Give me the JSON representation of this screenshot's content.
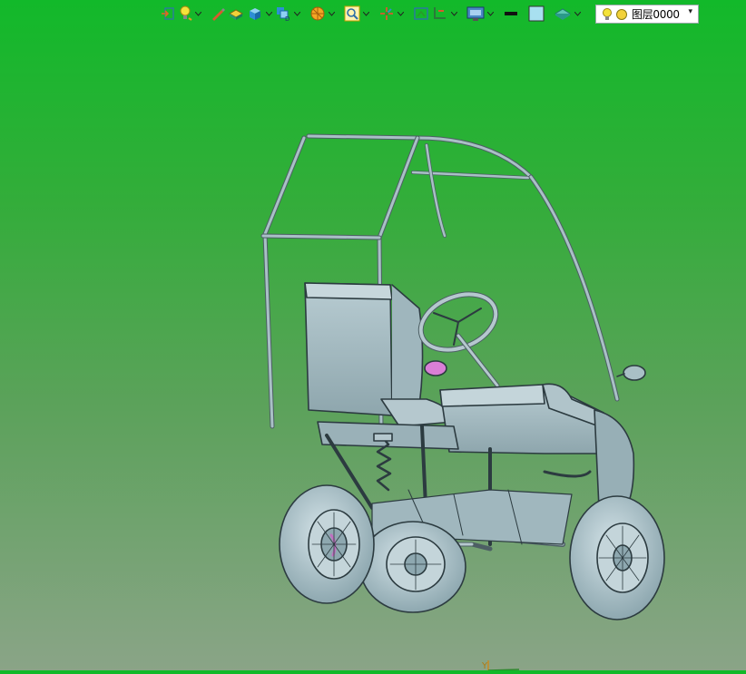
{
  "toolbar": {
    "icons": [
      "exit-icon",
      "light-bulb-icon",
      "pencil-icon",
      "box-yellow-icon",
      "cube-icon",
      "multi-cube-icon",
      "sphere-icon",
      "zoom-icon",
      "move-axes-icon",
      "frame-icon",
      "clip-icon",
      "display-icon",
      "line-icon",
      "color-square-icon",
      "layer-plate-icon"
    ]
  },
  "layer": {
    "value": "图层0000"
  },
  "viewport": {
    "model": "vehicle-frame-model",
    "axis_label": "Y"
  },
  "colors": {
    "bg_top": "#12b92a",
    "bg_bottom": "#8aa487",
    "model_fill": "#a3bcc4",
    "model_stroke": "#2c3b40",
    "accent_pink": "#d97fd6"
  }
}
